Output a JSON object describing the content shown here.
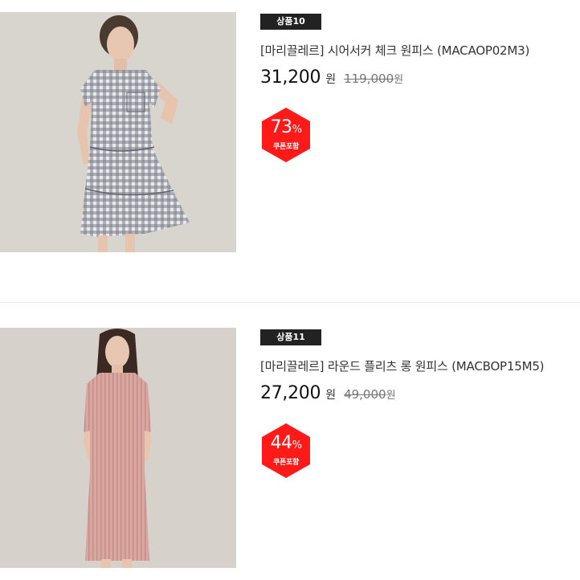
{
  "products": [
    {
      "badge": "상품10",
      "name": "[마리끌레르] 시어서커 체크 원피스 (MACAOP02M3)",
      "price": "31,200",
      "price_unit": "원",
      "original_price": "119,000",
      "original_unit": "원",
      "discount_value": "73",
      "discount_sign": "%",
      "coupon_label": "쿠폰포함"
    },
    {
      "badge": "상품11",
      "name": "[마리끌레르] 라운드 플리츠 롱 원피스 (MACBOP15M5)",
      "price": "27,200",
      "price_unit": "원",
      "original_price": "49,000",
      "original_unit": "원",
      "discount_value": "44",
      "discount_sign": "%",
      "coupon_label": "쿠폰포함"
    }
  ],
  "colors": {
    "badge_bg": "#222222",
    "discount_red": "#ff1a1a",
    "divider": "#ececec"
  }
}
